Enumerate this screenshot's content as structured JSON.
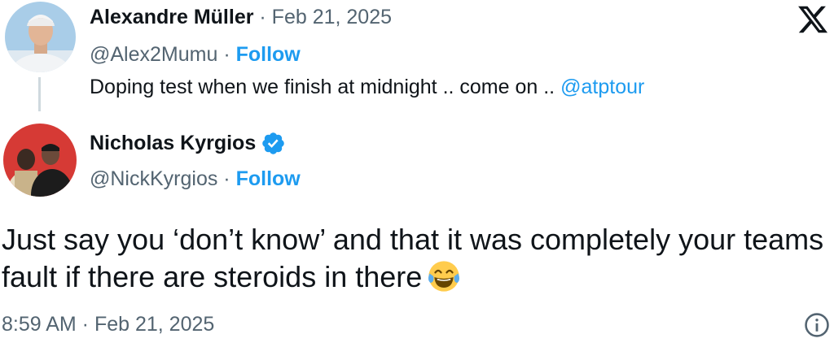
{
  "reply_tweet": {
    "display_name": "Alexandre Müller",
    "date": "Feb 21, 2025",
    "handle": "@Alex2Mumu",
    "follow_label": "Follow",
    "text": "Doping test when we finish at midnight .. come on ..",
    "mention": "@atptour"
  },
  "main_tweet": {
    "display_name": "Nicholas Kyrgios",
    "verified": true,
    "handle": "@NickKyrgios",
    "follow_label": "Follow",
    "text": "Just say you ‘don’t know’ and that it was completely your teams fault if there are steroids in there",
    "emoji": "face-with-tears-of-joy",
    "timestamp": "8:59 AM · Feb 21, 2025"
  },
  "separators": {
    "dot": " · "
  },
  "icons": {
    "brand": "x-logo-icon",
    "verified": "verified-badge-icon",
    "info": "info-icon"
  },
  "colors": {
    "link": "#1d9bf0",
    "muted": "#536471",
    "text": "#0f1419",
    "thread_line": "#cfd9de"
  }
}
